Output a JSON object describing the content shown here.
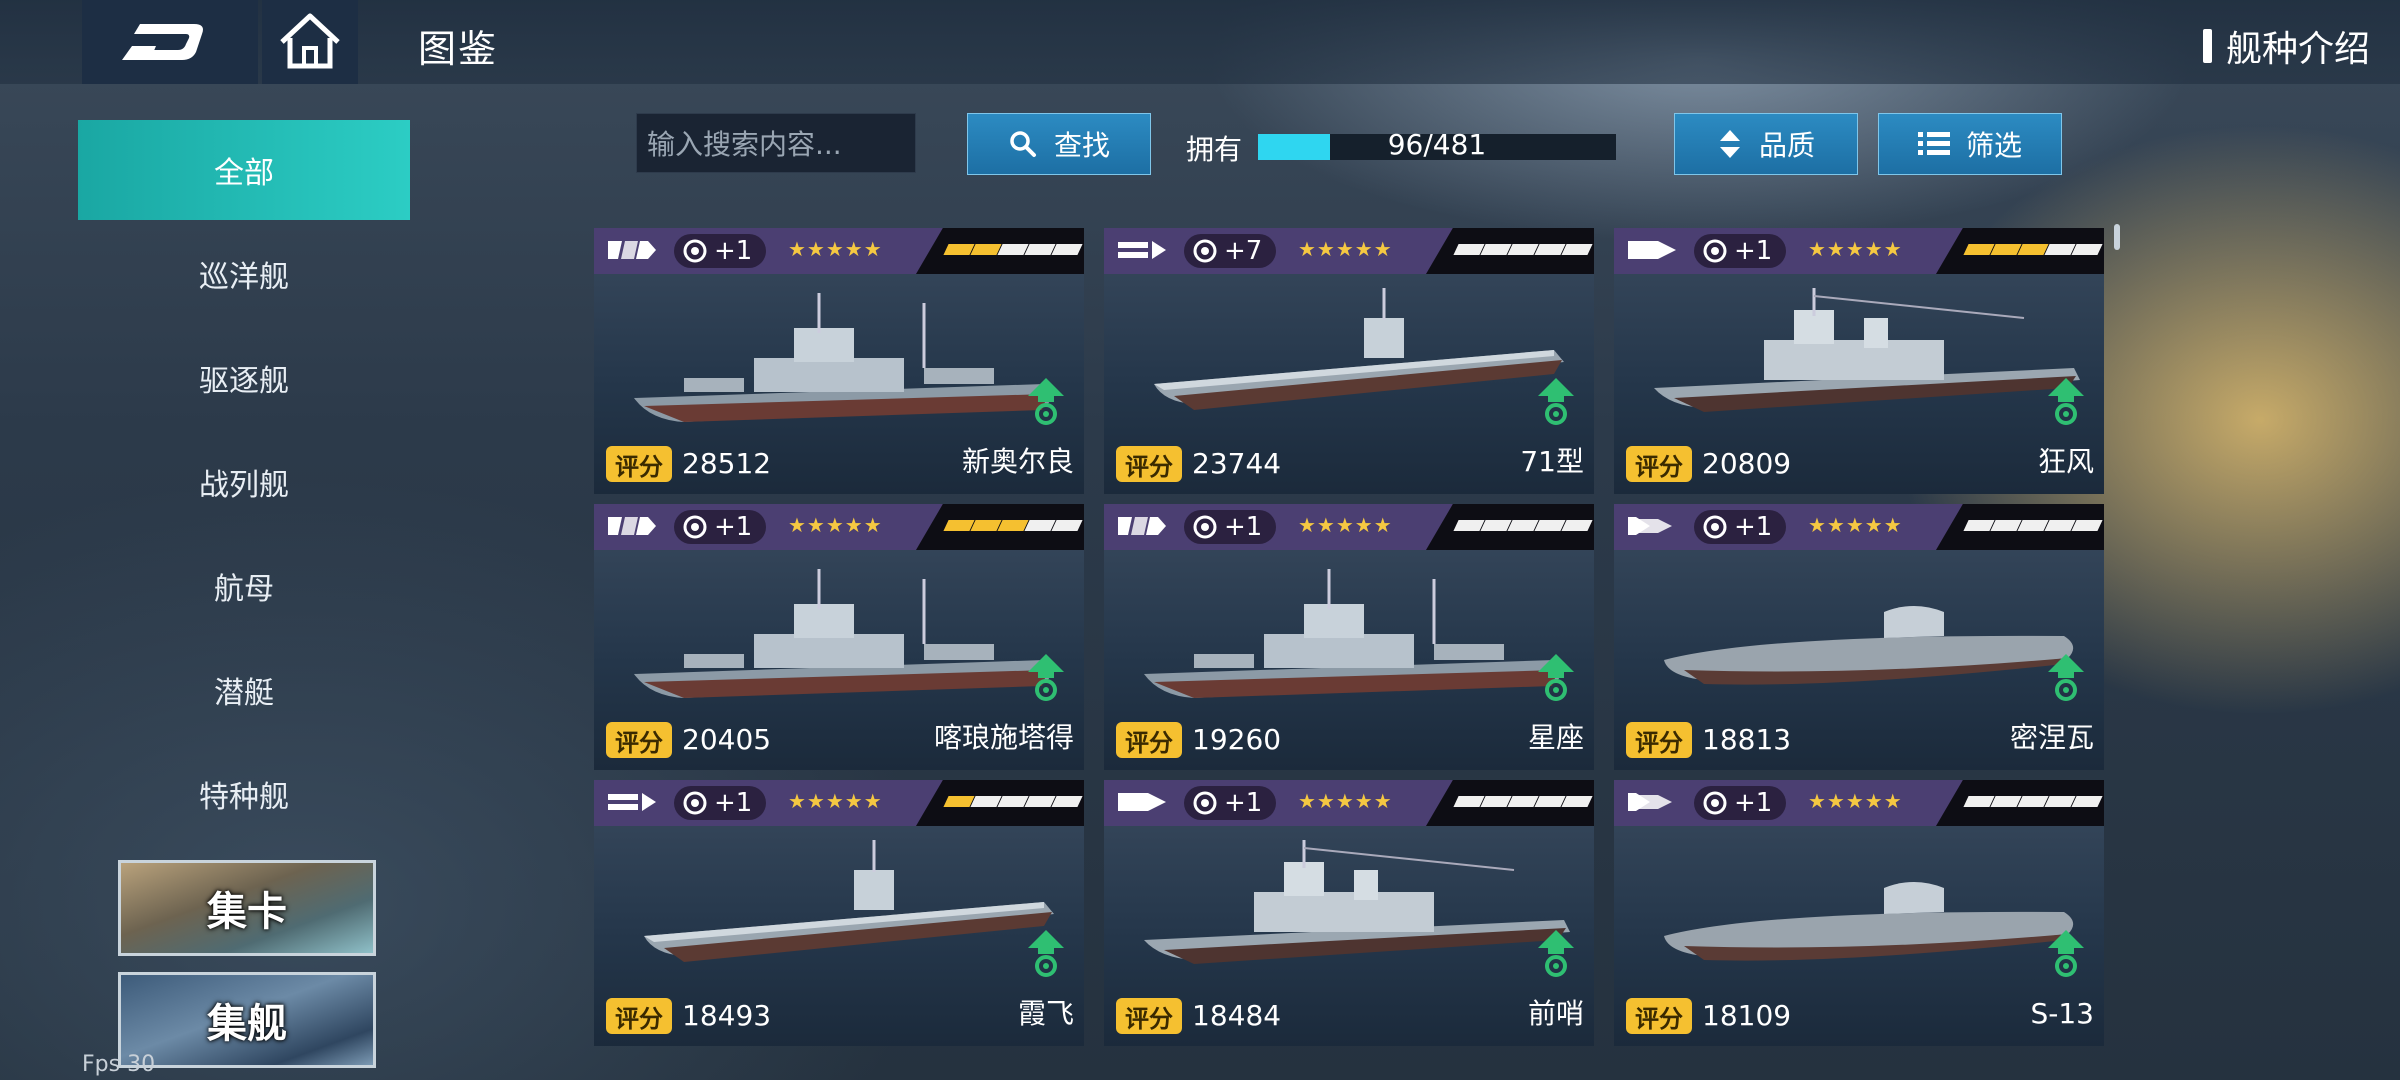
{
  "header": {
    "title": "图鉴",
    "ship_intro": "舰种介绍"
  },
  "sidebar": {
    "categories": [
      "全部",
      "巡洋舰",
      "驱逐舰",
      "战列舰",
      "航母",
      "潜艇",
      "特种舰"
    ],
    "active_index": 0,
    "cards": {
      "collect": "集卡",
      "fleet": "集舰"
    }
  },
  "toolbar": {
    "search_placeholder": "输入搜索内容...",
    "search_button": "查找",
    "own_label": "拥有",
    "own_text": "96/481",
    "own_progress": 0.2,
    "quality_button": "品质",
    "filter_button": "筛选"
  },
  "cards": [
    {
      "plus": "+1",
      "stars": "★★★★★",
      "level": 2,
      "score_label": "评分",
      "score": "28512",
      "name": "新奥尔良",
      "type_icon": "cruiser-icon"
    },
    {
      "plus": "+7",
      "stars": "★★★★★",
      "level": 0,
      "score_label": "评分",
      "score": "23744",
      "name": "71型",
      "type_icon": "carrier-icon"
    },
    {
      "plus": "+1",
      "stars": "★★★★★",
      "level": 3,
      "score_label": "评分",
      "score": "20809",
      "name": "狂风",
      "type_icon": "destroyer-icon"
    },
    {
      "plus": "+1",
      "stars": "★★★★★",
      "level": 3,
      "score_label": "评分",
      "score": "20405",
      "name": "喀琅施塔得",
      "type_icon": "cruiser-icon"
    },
    {
      "plus": "+1",
      "stars": "★★★★★",
      "level": 0,
      "score_label": "评分",
      "score": "19260",
      "name": "星座",
      "type_icon": "cruiser-icon"
    },
    {
      "plus": "+1",
      "stars": "★★★★★",
      "level": 0,
      "score_label": "评分",
      "score": "18813",
      "name": "密涅瓦",
      "type_icon": "submarine-icon"
    },
    {
      "plus": "+1",
      "stars": "★★★★★",
      "level": 1,
      "score_label": "评分",
      "score": "18493",
      "name": "霞飞",
      "type_icon": "carrier-icon"
    },
    {
      "plus": "+1",
      "stars": "★★★★★",
      "level": 0,
      "score_label": "评分",
      "score": "18484",
      "name": "前哨",
      "type_icon": "destroyer-icon"
    },
    {
      "plus": "+1",
      "stars": "★★★★★",
      "level": 0,
      "score_label": "评分",
      "score": "18109",
      "name": "S-13",
      "type_icon": "submarine-icon"
    }
  ],
  "debug": {
    "fps": "Fps 30"
  },
  "colors": {
    "accent": "#2ccdc4",
    "card_header": "#4b3f72",
    "score_badge": "#f5c030",
    "button": "#2680b8"
  }
}
